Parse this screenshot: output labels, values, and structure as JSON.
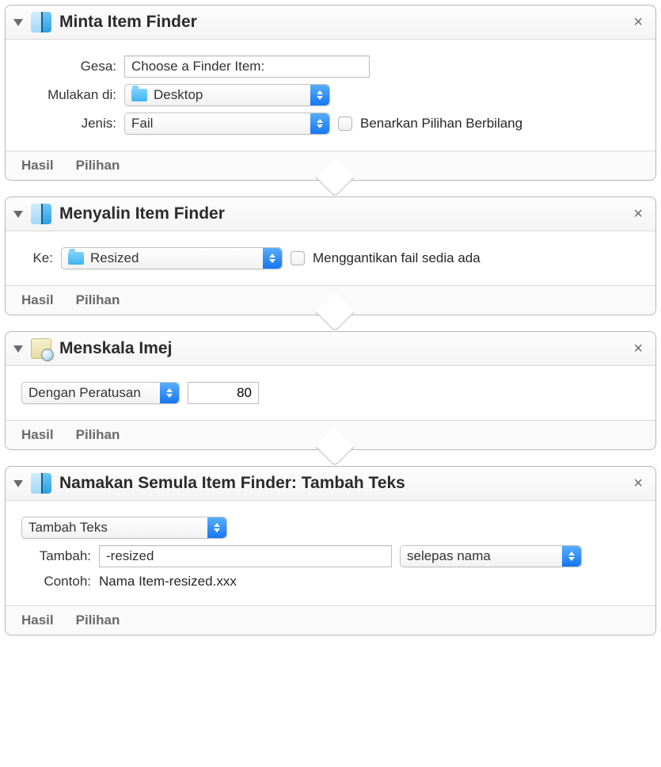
{
  "footer": {
    "results": "Hasil",
    "options": "Pilihan"
  },
  "actions": [
    {
      "title": "Minta Item Finder",
      "icon": "finder",
      "fields": {
        "prompt_label": "Gesa:",
        "prompt_value": "Choose a Finder Item:",
        "start_label": "Mulakan di:",
        "start_value": "Desktop",
        "type_label": "Jenis:",
        "type_value": "Fail",
        "allow_multi_label": "Benarkan Pilihan Berbilang"
      }
    },
    {
      "title": "Menyalin Item Finder",
      "icon": "finder",
      "fields": {
        "to_label": "Ke:",
        "to_value": "Resized",
        "replace_label": "Menggantikan fail sedia ada"
      }
    },
    {
      "title": "Menskala Imej",
      "icon": "preview",
      "fields": {
        "mode_value": "Dengan Peratusan",
        "percent_value": "80"
      }
    },
    {
      "title": "Namakan Semula Item Finder: Tambah Teks",
      "icon": "finder",
      "fields": {
        "operation_value": "Tambah Teks",
        "add_label": "Tambah:",
        "add_value": "-resized",
        "position_value": "selepas nama",
        "example_label": "Contoh:",
        "example_value": "Nama Item-resized.xxx"
      }
    }
  ]
}
